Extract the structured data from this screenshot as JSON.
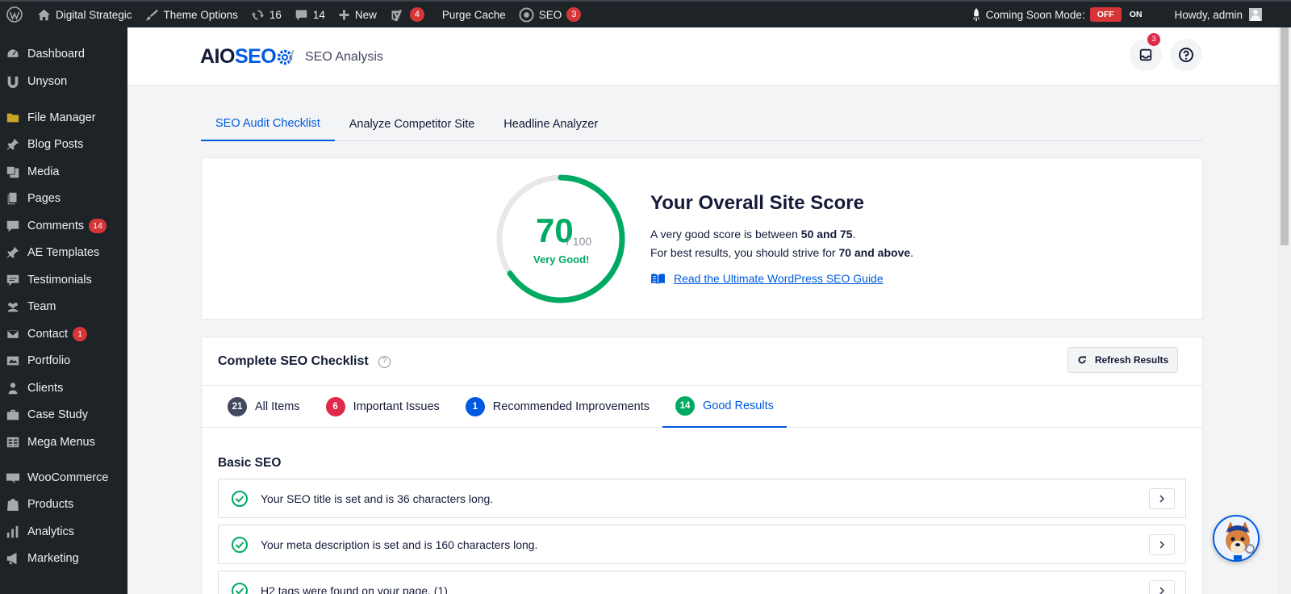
{
  "admin_bar": {
    "site_name": "Digital Strategic",
    "theme_options": "Theme Options",
    "updates_count": "16",
    "comments_count": "14",
    "new_label": "New",
    "yoast_badge": "4",
    "purge_cache": "Purge Cache",
    "seo_label": "SEO",
    "seo_badge": "3",
    "coming_soon_label": "Coming Soon Mode:",
    "off_label": "OFF",
    "on_label": "ON",
    "howdy": "Howdy, admin"
  },
  "sidebar": {
    "items": [
      {
        "label": "Dashboard",
        "icon": "dashboard-icon"
      },
      {
        "label": "Unyson",
        "icon": "unyson-icon"
      },
      {
        "label": "File Manager",
        "icon": "folder-icon"
      },
      {
        "label": "Blog Posts",
        "icon": "pin-icon"
      },
      {
        "label": "Media",
        "icon": "media-icon"
      },
      {
        "label": "Pages",
        "icon": "pages-icon"
      },
      {
        "label": "Comments",
        "icon": "comment-icon",
        "badge": "14"
      },
      {
        "label": "AE Templates",
        "icon": "pin-icon"
      },
      {
        "label": "Testimonials",
        "icon": "testimonial-icon"
      },
      {
        "label": "Team",
        "icon": "team-icon"
      },
      {
        "label": "Contact",
        "icon": "mail-icon",
        "badge": "1"
      },
      {
        "label": "Portfolio",
        "icon": "portfolio-icon"
      },
      {
        "label": "Clients",
        "icon": "clients-icon"
      },
      {
        "label": "Case Study",
        "icon": "case-icon"
      },
      {
        "label": "Mega Menus",
        "icon": "table-icon"
      },
      {
        "label": "WooCommerce",
        "icon": "woo-icon"
      },
      {
        "label": "Products",
        "icon": "products-icon"
      },
      {
        "label": "Analytics",
        "icon": "analytics-icon"
      },
      {
        "label": "Marketing",
        "icon": "megaphone-icon"
      }
    ]
  },
  "header": {
    "logo_aio": "AIO",
    "logo_seo": "SEO",
    "separator": "/",
    "breadcrumb": "SEO Analysis",
    "notifications_badge": "3"
  },
  "tabs": [
    "SEO Audit Checklist",
    "Analyze Competitor Site",
    "Headline Analyzer"
  ],
  "score": {
    "value": 70,
    "max": 100,
    "value_text": "70",
    "out_of": "/ 100",
    "rating": "Very Good!",
    "title": "Your Overall Site Score",
    "line1_pre": "A very good score is between ",
    "line1_bold": "50 and 75",
    "line1_post": ".",
    "line2_pre": "For best results, you should strive for ",
    "line2_bold": "70 and above",
    "line2_post": ".",
    "guide_link": "Read the Ultimate WordPress SEO Guide",
    "gauge_color": "#00aa63"
  },
  "checklist": {
    "title": "Complete SEO Checklist",
    "help": "?",
    "refresh": "Refresh Results",
    "filters": [
      {
        "count": "21",
        "label": "All Items",
        "color": "#434960"
      },
      {
        "count": "6",
        "label": "Important Issues",
        "color": "#df2a4a"
      },
      {
        "count": "1",
        "label": "Recommended Improvements",
        "color": "#005ae0"
      },
      {
        "count": "14",
        "label": "Good Results",
        "color": "#00aa63"
      }
    ],
    "section": "Basic SEO",
    "results": [
      "Your SEO title is set and is 36 characters long.",
      "Your meta description is set and is 160 characters long.",
      "H2 tags were found on your page. (1)"
    ]
  }
}
